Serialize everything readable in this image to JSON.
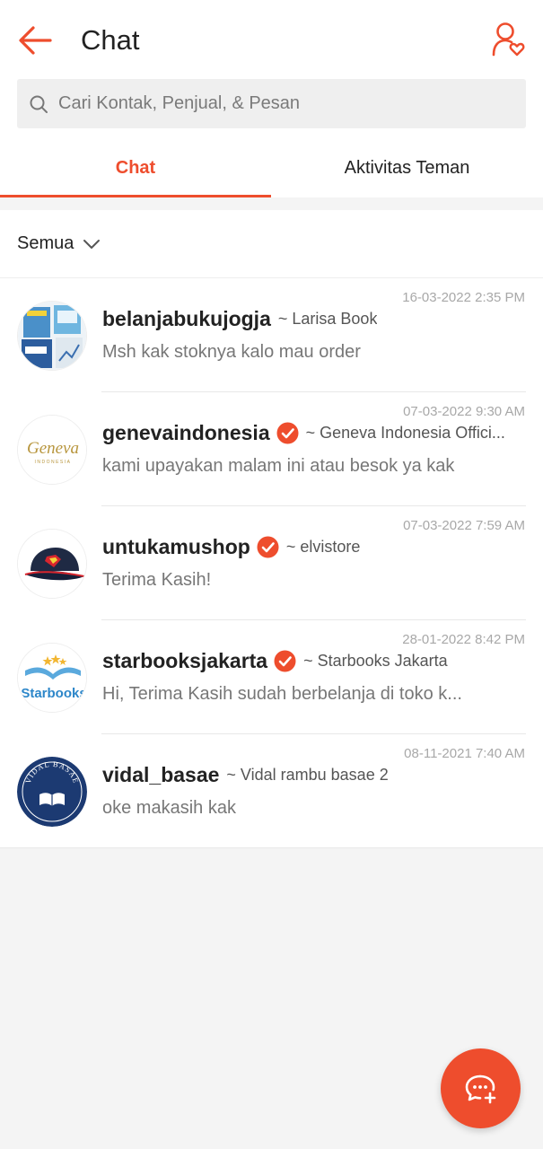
{
  "header": {
    "title": "Chat",
    "back_icon": "arrow-left-icon",
    "friends_icon": "user-heart-icon",
    "accent": "#ee4d2d"
  },
  "search": {
    "placeholder": "Cari Kontak, Penjual, & Pesan",
    "icon": "search-icon"
  },
  "tabs": [
    {
      "label": "Chat",
      "active": true
    },
    {
      "label": "Aktivitas Teman",
      "active": false
    }
  ],
  "filter": {
    "label": "Semua",
    "icon": "chevron-down-icon"
  },
  "chats": [
    {
      "name": "belanjabukujogja",
      "subtitle": "~ Larisa Book",
      "message": "Msh kak stoknya kalo mau order",
      "time": "16-03-2022 2:35 PM",
      "verified": false,
      "avatar": "book-covers-avatar"
    },
    {
      "name": "genevaindonesia",
      "subtitle": "~ Geneva Indonesia Offici...",
      "message": "kami upayakan malam ini atau besok ya kak",
      "time": "07-03-2022 9:30 AM",
      "verified": true,
      "avatar": "geneva-logo-avatar",
      "avatar_text": "Geneva",
      "avatar_subtext": "INDONESIA"
    },
    {
      "name": "untukamushop",
      "subtitle": "~ elvistore",
      "message": "Terima Kasih!",
      "time": "07-03-2022 7:59 AM",
      "verified": true,
      "avatar": "baseball-cap-avatar"
    },
    {
      "name": "starbooksjakarta",
      "subtitle": "~ Starbooks Jakarta",
      "message": "Hi, Terima Kasih sudah berbelanja di toko k...",
      "time": "28-01-2022 8:42 PM",
      "verified": true,
      "avatar": "starbooks-logo-avatar",
      "avatar_text": "Starbooks"
    },
    {
      "name": "vidal_basae",
      "subtitle": "~ Vidal rambu basae 2",
      "message": "oke makasih kak",
      "time": "08-11-2021 7:40 AM",
      "verified": false,
      "avatar": "vidal-basae-logo-avatar",
      "avatar_text": "VIDAL BASAE"
    }
  ],
  "fab": {
    "icon": "new-chat-icon"
  }
}
